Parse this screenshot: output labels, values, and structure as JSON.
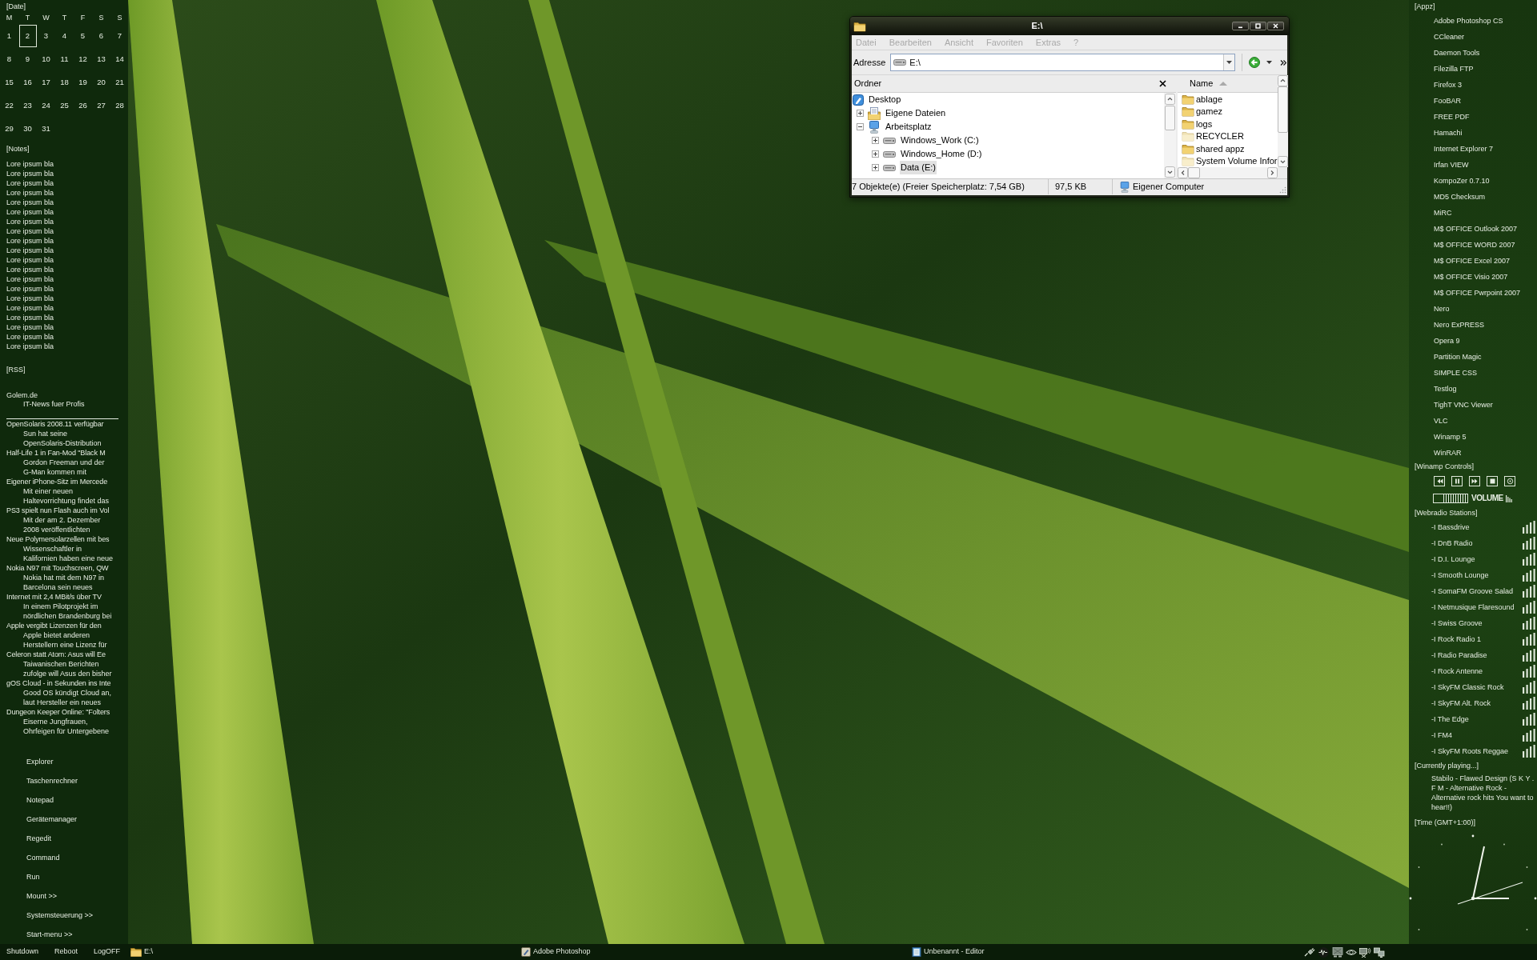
{
  "left_panel": {
    "date_heading": "[Date]",
    "weekdays": [
      "M",
      "T",
      "W",
      "T",
      "F",
      "S",
      "S"
    ],
    "days": [
      {
        "label": "1",
        "selected": false
      },
      {
        "label": "2",
        "selected": true
      },
      {
        "label": "3",
        "selected": false
      },
      {
        "label": "4",
        "selected": false
      },
      {
        "label": "5",
        "selected": false
      },
      {
        "label": "6",
        "selected": false
      },
      {
        "label": "7",
        "selected": false
      },
      {
        "label": "8",
        "selected": false
      },
      {
        "label": "9",
        "selected": false
      },
      {
        "label": "10",
        "selected": false
      },
      {
        "label": "11",
        "selected": false
      },
      {
        "label": "12",
        "selected": false
      },
      {
        "label": "13",
        "selected": false
      },
      {
        "label": "14",
        "selected": false
      },
      {
        "label": "15",
        "selected": false
      },
      {
        "label": "16",
        "selected": false
      },
      {
        "label": "17",
        "selected": false
      },
      {
        "label": "18",
        "selected": false
      },
      {
        "label": "19",
        "selected": false
      },
      {
        "label": "20",
        "selected": false
      },
      {
        "label": "21",
        "selected": false
      },
      {
        "label": "22",
        "selected": false
      },
      {
        "label": "23",
        "selected": false
      },
      {
        "label": "24",
        "selected": false
      },
      {
        "label": "25",
        "selected": false
      },
      {
        "label": "26",
        "selected": false
      },
      {
        "label": "27",
        "selected": false
      },
      {
        "label": "28",
        "selected": false
      },
      {
        "label": "29",
        "selected": false
      },
      {
        "label": "30",
        "selected": false
      },
      {
        "label": "31",
        "selected": false
      }
    ],
    "notes_heading": "[Notes]",
    "notes": [
      "Lore ipsum bla",
      "Lore ipsum bla",
      "Lore ipsum bla",
      "Lore ipsum bla",
      "Lore ipsum bla",
      "Lore ipsum bla",
      "Lore ipsum bla",
      "Lore ipsum bla",
      "Lore ipsum bla",
      "Lore ipsum bla",
      "Lore ipsum bla",
      "Lore ipsum bla",
      "Lore ipsum bla",
      "Lore ipsum bla",
      "Lore ipsum bla",
      "Lore ipsum bla",
      "Lore ipsum bla",
      "Lore ipsum bla",
      "Lore ipsum bla",
      "Lore ipsum bla"
    ],
    "rss_heading": "[RSS]",
    "feed": {
      "title": "Golem.de",
      "subtitle": "IT-News fuer Profis"
    },
    "rss_items": [
      {
        "title": "OpenSolaris 2008.11 verfügbar",
        "summary_lines": [
          "Sun hat seine",
          "OpenSolaris-Distribution"
        ]
      },
      {
        "title": "Half-Life 1 in Fan-Mod \"Black M",
        "summary_lines": [
          "Gordon Freeman und der",
          "G-Man kommen mit"
        ]
      },
      {
        "title": "Eigener iPhone-Sitz im Mercede",
        "summary_lines": [
          "Mit einer neuen",
          "Haltevorrichtung findet das"
        ]
      },
      {
        "title": "PS3 spielt nun Flash auch im Vol",
        "summary_lines": [
          "Mit der am 2. Dezember",
          "2008 veröffentlichten"
        ]
      },
      {
        "title": "Neue Polymersolarzellen mit bes",
        "summary_lines": [
          "Wissenschaftler in",
          "Kalifornien haben eine neue"
        ]
      },
      {
        "title": "Nokia N97 mit Touchscreen, QW",
        "summary_lines": [
          "Nokia hat mit dem N97 in",
          "Barcelona sein neues"
        ]
      },
      {
        "title": "Internet mit 2,4 MBit/s über TV",
        "summary_lines": [
          "In einem Pilotprojekt im",
          "nördlichen Brandenburg bei"
        ]
      },
      {
        "title": "Apple vergibt Lizenzen für den",
        "summary_lines": [
          "Apple bietet anderen",
          "Herstellern eine Lizenz für"
        ]
      },
      {
        "title": "Celeron statt Atom: Asus will Ee",
        "summary_lines": [
          "Taiwanischen Berichten",
          "zufolge will Asus den bisher"
        ]
      },
      {
        "title": "gOS Cloud - in Sekunden ins Inte",
        "summary_lines": [
          "Good OS kündigt Cloud an,",
          "laut Hersteller ein neues"
        ]
      },
      {
        "title": "Dungeon Keeper Online: \"Folters",
        "summary_lines": [
          "Eiserne Jungfrauen,",
          "Ohrfeigen für Untergebene"
        ]
      }
    ],
    "launcher": [
      "Explorer",
      "Taschenrechner",
      "Notepad",
      "Gerätemanager",
      "Regedit",
      "Command",
      "Run",
      "Mount >>",
      "Systemsteuerung >>",
      "Start-menu >>"
    ]
  },
  "explorer_window": {
    "title": "E:\\",
    "menu": [
      {
        "label": "Datei",
        "disabled": true
      },
      {
        "label": "Bearbeiten",
        "disabled": true
      },
      {
        "label": "Ansicht",
        "disabled": true
      },
      {
        "label": "Favoriten",
        "disabled": true
      },
      {
        "label": "Extras",
        "disabled": true
      },
      {
        "label": "?",
        "disabled": true
      }
    ],
    "address": {
      "label": "Adresse",
      "value": "E:\\"
    },
    "folder_pane": {
      "title": "Ordner",
      "tree": [
        {
          "label": "Desktop",
          "kind": "desktop",
          "selected": false,
          "children": [
            {
              "label": "Eigene Dateien",
              "kind": "documents",
              "expanded": false,
              "selected": false
            },
            {
              "label": "Arbeitsplatz",
              "kind": "computer",
              "expanded": true,
              "selected": false,
              "children": [
                {
                  "label": "Windows_Work (C:)",
                  "kind": "drive",
                  "expanded": false,
                  "selected": false
                },
                {
                  "label": "Windows_Home (D:)",
                  "kind": "drive",
                  "expanded": false,
                  "selected": false
                },
                {
                  "label": "Data (E:)",
                  "kind": "drive",
                  "expanded": false,
                  "selected": true
                }
              ]
            }
          ]
        }
      ]
    },
    "file_pane": {
      "column": "Name",
      "sorted_ascending": true,
      "files": [
        {
          "name": "ablage",
          "hidden": false
        },
        {
          "name": "gamez",
          "hidden": false
        },
        {
          "name": "logs",
          "hidden": false
        },
        {
          "name": "RECYCLER",
          "hidden": true
        },
        {
          "name": "shared appz",
          "hidden": false
        },
        {
          "name": "System Volume Infor",
          "hidden": true
        }
      ]
    },
    "status_bar": {
      "summary": "7 Objekte(e) (Freier Speicherplatz: 7,54 GB)",
      "size": "97,5 KB",
      "location": "Eigener Computer"
    }
  },
  "right_panel": {
    "apps_heading": "[Appz]",
    "apps": [
      "Adobe Photoshop CS",
      "CCleaner",
      "Daemon Tools",
      "Filezilla FTP",
      "Firefox 3",
      "FooBAR",
      "FREE PDF",
      "Hamachi",
      "Internet Explorer 7",
      "Irfan VIEW",
      "KompoZer 0.7.10",
      "MD5 Checksum",
      "MiRC",
      "M$ OFFICE Outlook 2007",
      "M$ OFFICE WORD 2007",
      "M$ OFFICE Excel 2007",
      "M$ OFFICE Visio 2007",
      "M$ OFFICE Pwrpoint 2007",
      "Nero",
      "Nero ExPRESS",
      "Opera 9",
      "Partition Magic",
      "SIMPLE CSS",
      "Testlog",
      "TighT VNC Viewer",
      "VLC",
      "Winamp 5",
      "WinRAR"
    ],
    "winamp_heading": "[Winamp Controls]",
    "volume": {
      "label": "VOLUME",
      "level": 0.72
    },
    "stations_heading": "[Webradio Stations]",
    "stations": [
      "-I Bassdrive",
      "-I DnB Radio",
      "-I D.I. Lounge",
      "-I Smooth Lounge",
      "-I SomaFM Groove Salad",
      "-I Netmusique Flaresound",
      "-I Swiss Groove",
      "-I Rock Radio 1",
      "-I Radio Paradise",
      "-I Rock Antenne",
      "-I SkyFM Classic Rock",
      "-I SkyFM Alt. Rock",
      "-I The Edge",
      "-I FM4",
      "-I SkyFM Roots Reggae"
    ],
    "now_playing_heading": "[Currently playing...]",
    "now_playing": "Stabilo - Flawed Design (S K Y . F M - Alternative Rock - Alternative rock hits You want to hear!!)",
    "time_heading": "[Time (GMT+1:00)]"
  },
  "taskbar": {
    "actions": [
      "Shutdown",
      "Reboot",
      "LogOFF"
    ],
    "tasks": [
      {
        "label": "E:\\",
        "kind": "folder"
      },
      {
        "label": "Adobe Photoshop",
        "kind": "photoshop"
      },
      {
        "label": "Unbenannt - Editor",
        "kind": "notepad"
      }
    ]
  }
}
